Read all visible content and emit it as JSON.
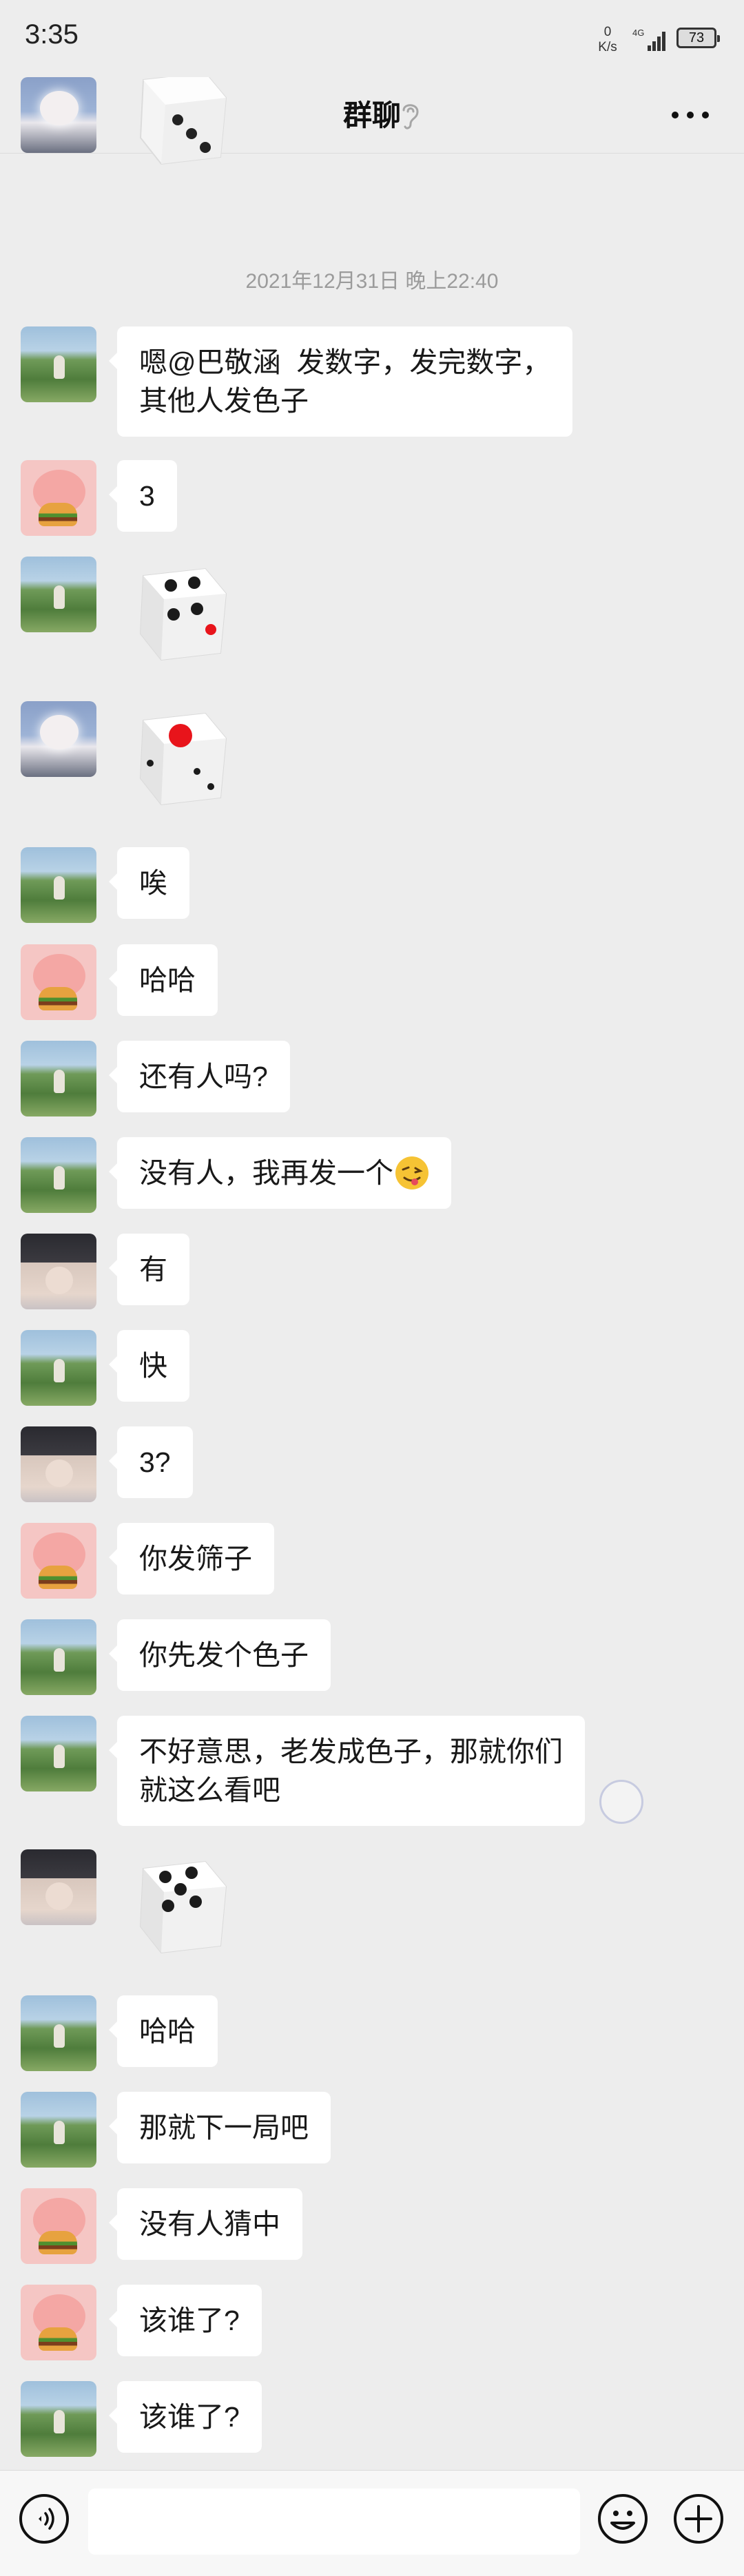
{
  "status_bar": {
    "time": "3:35",
    "net_speed_value": "0",
    "net_speed_unit": "K/s",
    "network_type": "4G",
    "battery": "73"
  },
  "nav": {
    "title": "群聊"
  },
  "timestamp": "2021年12月31日 晚上22:40",
  "messages": [
    {
      "type": "text",
      "avatar": "landscape",
      "text": "嗯@巴敬涵  发数字，发完数字，\n其他人发色子"
    },
    {
      "type": "text",
      "avatar": "pig",
      "text": "3"
    },
    {
      "type": "dice",
      "avatar": "landscape",
      "dice_value": 4
    },
    {
      "type": "dice",
      "avatar": "cloud",
      "dice_value": 1
    },
    {
      "type": "text",
      "avatar": "landscape",
      "text": "唉"
    },
    {
      "type": "text",
      "avatar": "pig",
      "text": "哈哈"
    },
    {
      "type": "text",
      "avatar": "landscape",
      "text": "还有人吗?"
    },
    {
      "type": "text",
      "avatar": "landscape",
      "text": "没有人，我再发一个",
      "emoji": "winking-face-tongue"
    },
    {
      "type": "text",
      "avatar": "boy",
      "text": "有"
    },
    {
      "type": "text",
      "avatar": "landscape",
      "text": "快"
    },
    {
      "type": "text",
      "avatar": "boy",
      "text": "3?"
    },
    {
      "type": "text",
      "avatar": "pig",
      "text": "你发筛子"
    },
    {
      "type": "text",
      "avatar": "landscape",
      "text": "你先发个色子"
    },
    {
      "type": "text",
      "avatar": "landscape",
      "text": "不好意思，老发成色子，那就你们\n就这么看吧"
    },
    {
      "type": "dice",
      "avatar": "boy",
      "dice_value": 5
    },
    {
      "type": "text",
      "avatar": "landscape",
      "text": "哈哈"
    },
    {
      "type": "text",
      "avatar": "landscape",
      "text": "那就下一局吧"
    },
    {
      "type": "text",
      "avatar": "pig",
      "text": "没有人猜中"
    },
    {
      "type": "text",
      "avatar": "pig",
      "text": "该谁了?"
    },
    {
      "type": "text",
      "avatar": "landscape",
      "text": "该谁了?"
    }
  ],
  "input_bar": {
    "placeholder": ""
  },
  "colors": {
    "background": "#ededed",
    "bubble": "#ffffff",
    "dice_red_pip": "#e8141b"
  }
}
